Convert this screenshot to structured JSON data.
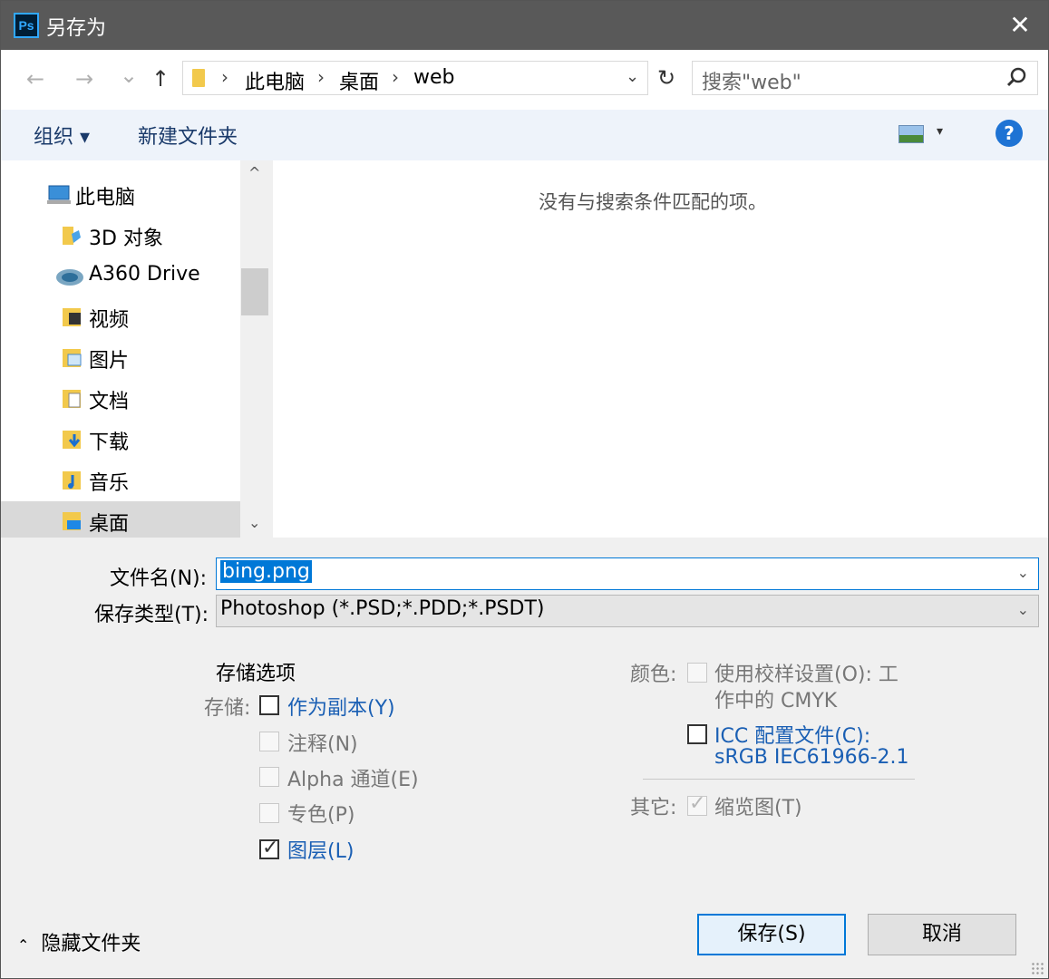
{
  "window": {
    "title": "另存为",
    "app_icon": "Ps",
    "close": "✕"
  },
  "nav": {
    "back": "←",
    "forward": "→",
    "recent": "⌄",
    "up": "↑",
    "breadcrumbs": [
      "此电脑",
      "桌面",
      "web"
    ],
    "separator": "›",
    "refresh": "↻",
    "search_placeholder": "搜索\"web\"",
    "search_icon": "⚲"
  },
  "toolbar": {
    "organize": "组织 ▾",
    "new_folder": "新建文件夹",
    "help": "?"
  },
  "tree": [
    {
      "label": "此电脑",
      "icon": "computer-icon"
    },
    {
      "label": "3D 对象",
      "icon": "3d-objects-icon"
    },
    {
      "label": "A360 Drive",
      "icon": "a360-drive-icon"
    },
    {
      "label": "视频",
      "icon": "videos-icon"
    },
    {
      "label": "图片",
      "icon": "pictures-icon"
    },
    {
      "label": "文档",
      "icon": "documents-icon"
    },
    {
      "label": "下载",
      "icon": "downloads-icon"
    },
    {
      "label": "音乐",
      "icon": "music-icon"
    },
    {
      "label": "桌面",
      "icon": "desktop-icon",
      "selected": true
    }
  ],
  "content": {
    "empty_message": "没有与搜索条件匹配的项。"
  },
  "form": {
    "filename_label": "文件名(N):",
    "filename_value": "bing.png",
    "type_label": "保存类型(T):",
    "type_value": "Photoshop (*.PSD;*.PDD;*.PSDT)"
  },
  "options": {
    "header": "存储选项",
    "save_label": "存储:",
    "as_copy": "作为副本(Y)",
    "notes": "注释(N)",
    "alpha": "Alpha 通道(E)",
    "spot": "专色(P)",
    "layers": "图层(L)",
    "color_label": "颜色:",
    "proof_setup_1": "使用校样设置(O):  工",
    "proof_setup_2": "作中的 CMYK",
    "icc_1": "ICC 配置文件(C):",
    "icc_2": "sRGB IEC61966-2.1",
    "other_label": "其它:",
    "thumbnail": "缩览图(T)"
  },
  "footer": {
    "hide_folders": "隐藏文件夹",
    "save": "保存(S)",
    "cancel": "取消"
  },
  "colors": {
    "accent": "#0078d7",
    "titlebar": "#595959",
    "link_blue": "#1a5fb4"
  }
}
